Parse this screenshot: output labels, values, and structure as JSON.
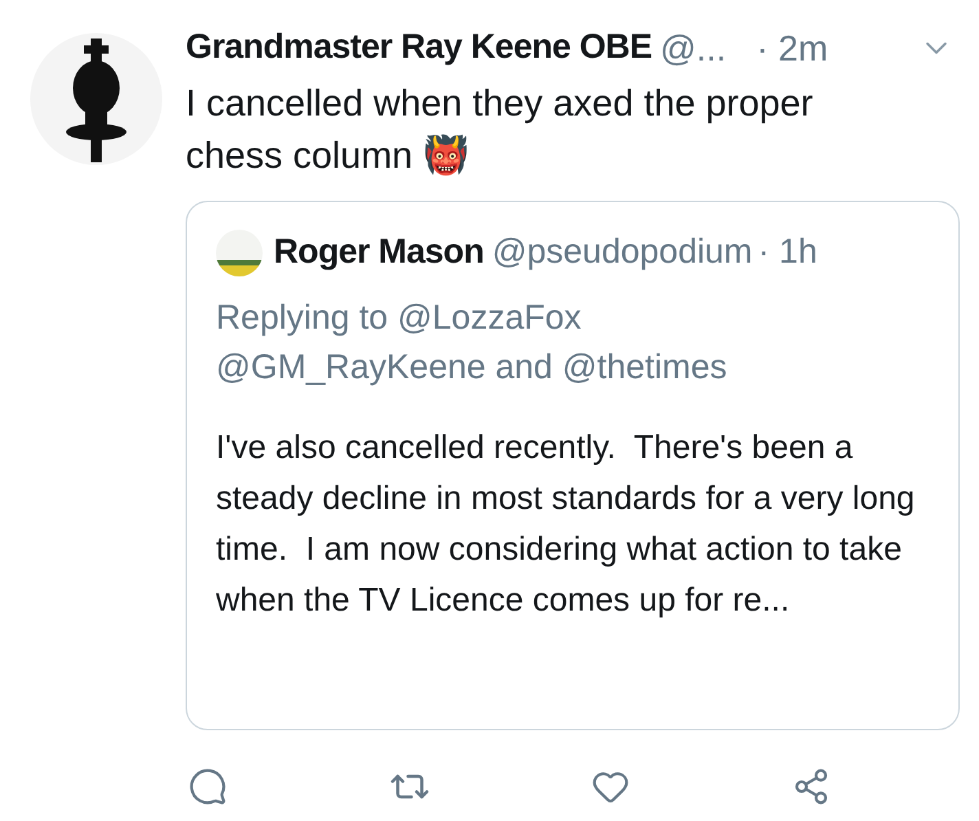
{
  "tweet": {
    "author_name": "Grandmaster Ray Keene OBE",
    "handle": "@...",
    "time": "· 2m",
    "text": "I cancelled when they axed the proper chess column 👹",
    "quote": {
      "author_name": "Roger Mason",
      "handle": "@pseudopodium",
      "time": "· 1h",
      "replying_to": "Replying to @LozzaFox @GM_RayKeene and @thetimes",
      "text": "I've also cancelled recently.  There's been a steady decline in most standards for a very long time.  I am now considering what action to take when the TV Licence comes up for re..."
    }
  }
}
